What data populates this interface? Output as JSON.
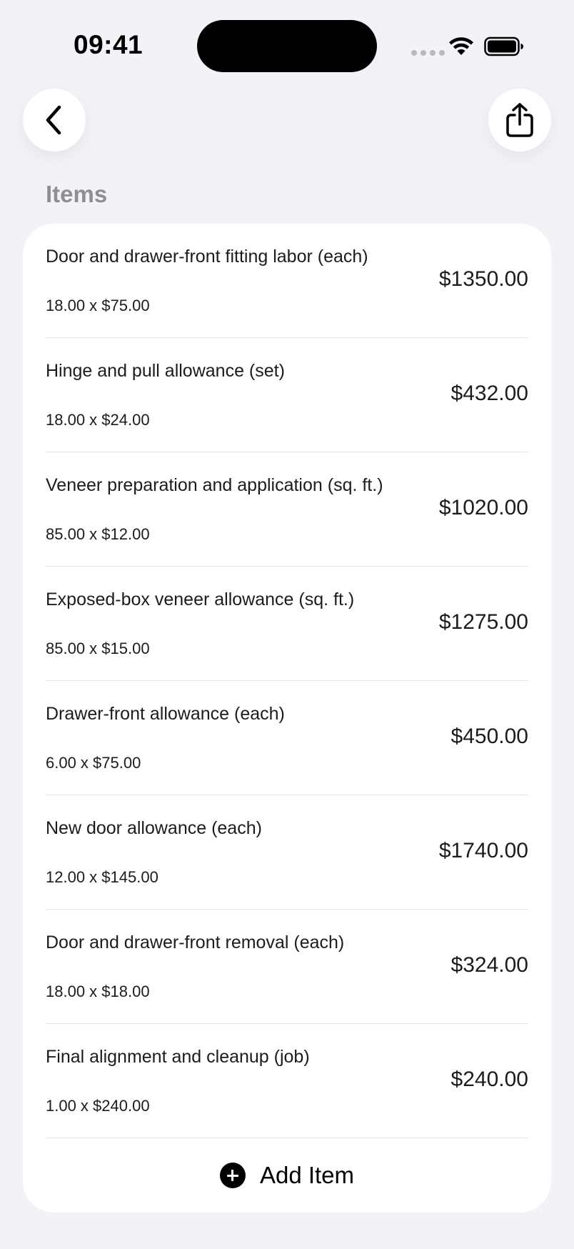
{
  "status_bar": {
    "time": "09:41"
  },
  "nav": {
    "back_icon": "chevron-left-icon",
    "share_icon": "share-icon"
  },
  "section": {
    "title": "Items"
  },
  "items": [
    {
      "name": "Door and drawer-front fitting labor (each)",
      "qty_price": "18.00 x $75.00",
      "total": "$1350.00"
    },
    {
      "name": "Hinge and pull allowance (set)",
      "qty_price": "18.00 x $24.00",
      "total": "$432.00"
    },
    {
      "name": "Veneer preparation and application (sq. ft.)",
      "qty_price": "85.00 x $12.00",
      "total": "$1020.00"
    },
    {
      "name": "Exposed-box veneer allowance (sq. ft.)",
      "qty_price": "85.00 x $15.00",
      "total": "$1275.00"
    },
    {
      "name": "Drawer-front allowance (each)",
      "qty_price": "6.00 x $75.00",
      "total": "$450.00"
    },
    {
      "name": "New door allowance (each)",
      "qty_price": "12.00 x $145.00",
      "total": "$1740.00"
    },
    {
      "name": "Door and drawer-front removal (each)",
      "qty_price": "18.00 x $18.00",
      "total": "$324.00"
    },
    {
      "name": "Final alignment and cleanup (job)",
      "qty_price": "1.00 x $240.00",
      "total": "$240.00"
    }
  ],
  "add_item": {
    "label": "Add Item",
    "icon": "plus-circle-icon"
  },
  "colors": {
    "background": "#f2f2f7",
    "card": "#ffffff",
    "secondary_text": "#8e8e93",
    "divider": "#e3e3e8"
  }
}
